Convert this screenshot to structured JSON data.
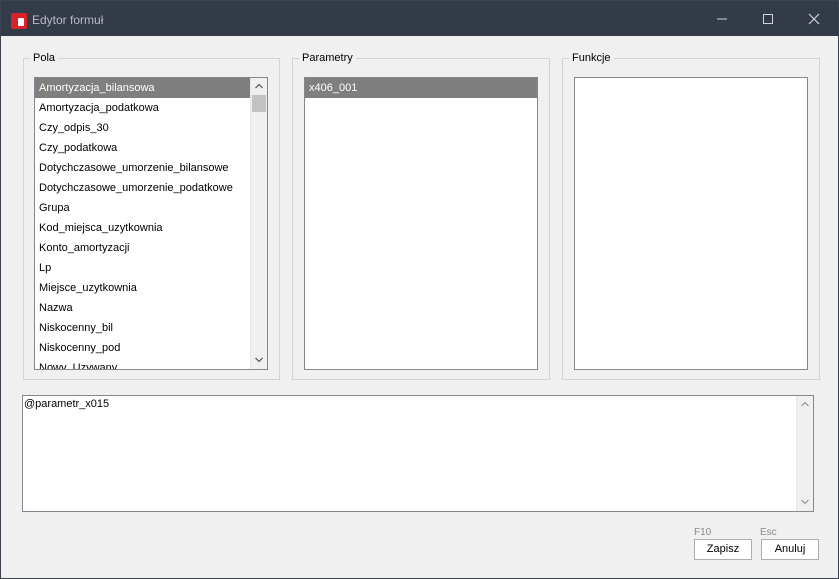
{
  "window": {
    "title": "Edytor formuł"
  },
  "groups": {
    "pola": {
      "label": "Pola",
      "items": [
        "Amortyzacja_bilansowa",
        "Amortyzacja_podatkowa",
        "Czy_odpis_30",
        "Czy_podatkowa",
        "Dotychczasowe_umorzenie_bilansowe",
        "Dotychczasowe_umorzenie_podatkowe",
        "Grupa",
        "Kod_miejsca_uzytkownia",
        "Konto_amortyzacji",
        "Lp",
        "Miejsce_uzytkownia",
        "Nazwa",
        "Niskocenny_bil",
        "Niskocenny_pod",
        "Nowy_Uzywany"
      ],
      "selected_index": 0
    },
    "parametry": {
      "label": "Parametry",
      "items": [
        "x406_001"
      ],
      "selected_index": 0
    },
    "funkcje": {
      "label": "Funkcje",
      "items": []
    }
  },
  "editor": {
    "value": "@parametr_x015"
  },
  "buttons": {
    "save": {
      "label": "Zapisz",
      "shortcut": "F10"
    },
    "cancel": {
      "label": "Anuluj",
      "shortcut": "Esc"
    }
  },
  "colors": {
    "titlebar": "#333b48",
    "selection": "#7f7f7f",
    "app_icon": "#d8222a"
  }
}
